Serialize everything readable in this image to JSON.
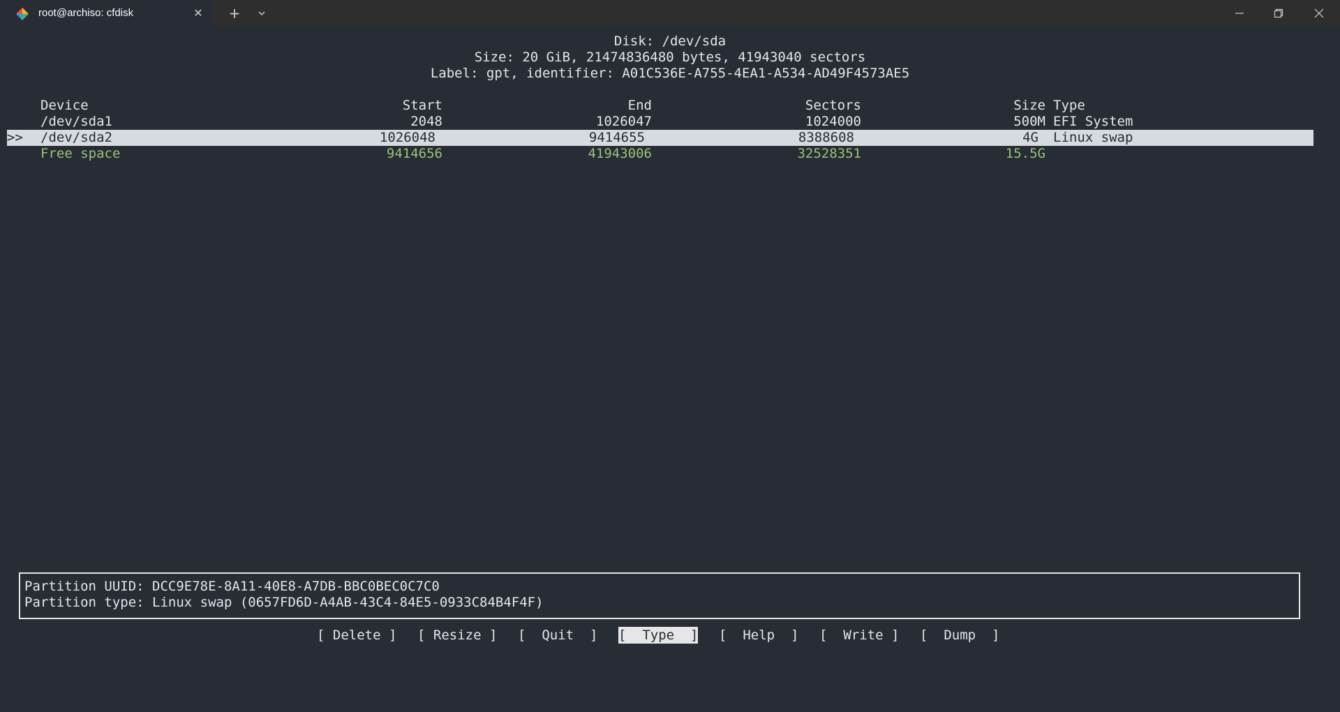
{
  "window": {
    "tab_title": "root@archiso: cfdisk",
    "tab_icon": "terminal-app-icon",
    "close_tab_glyph": "✕",
    "new_tab_glyph": "+",
    "dropdown_glyph": "⌄",
    "colors": {
      "titlebar": "#2e2e2e",
      "background": "#282c34",
      "foreground": "#e6e6e6",
      "free_space": "#98c379",
      "selection": "#d7dae0"
    }
  },
  "disk": {
    "line1": "Disk: /dev/sda",
    "line2": "Size: 20 GiB, 21474836480 bytes, 41943040 sectors",
    "line3": "Label: gpt, identifier: A01C536E-A755-4EA1-A534-AD49F4573AE5"
  },
  "table": {
    "headers": {
      "device": "Device",
      "start": "Start",
      "end": "End",
      "sectors": "Sectors",
      "size": "Size",
      "type": "Type"
    },
    "rows": [
      {
        "marker": "",
        "device": "/dev/sda1",
        "start": "2048",
        "end": "1026047",
        "sectors": "1024000",
        "size": "500M",
        "type": "EFI System"
      },
      {
        "marker": ">>",
        "device": "/dev/sda2",
        "start": "1026048",
        "end": "9414655",
        "sectors": "8388608",
        "size": "4G",
        "type": "Linux swap"
      },
      {
        "marker": "",
        "device": "Free space",
        "start": "9414656",
        "end": "41943006",
        "sectors": "32528351",
        "size": "15.5G",
        "type": ""
      }
    ]
  },
  "info": {
    "uuid": "Partition UUID: DCC9E78E-8A11-40E8-A7DB-BBC0BEC0C7C0",
    "type": "Partition type: Linux swap (0657FD6D-A4AB-43C4-84E5-0933C84B4F4F)"
  },
  "menu": {
    "delete": "[ Delete ]",
    "resize": "[ Resize ]",
    "quit": "[  Quit  ]",
    "type": "[  Type  ]",
    "help": "[  Help  ]",
    "write": "[  Write ]",
    "dump": "[  Dump  ]",
    "active": "type"
  }
}
